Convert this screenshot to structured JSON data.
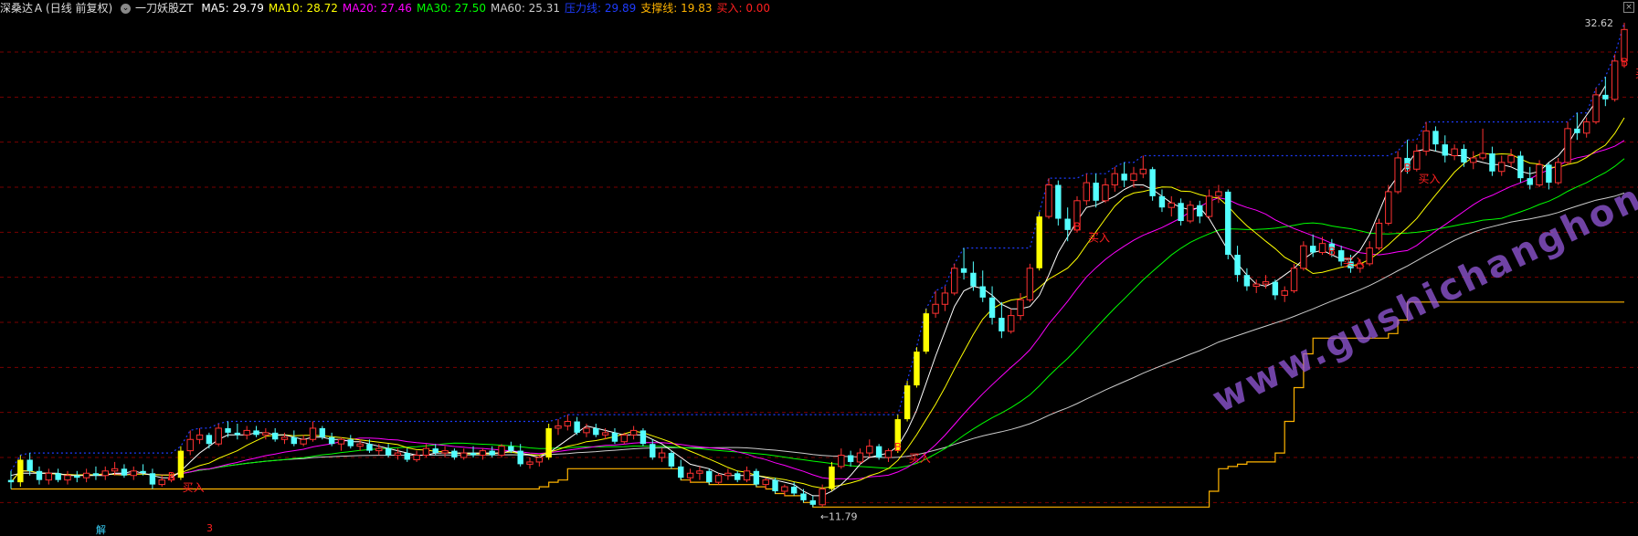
{
  "header": {
    "stock_name": "深桑达Ａ",
    "period": "(日线 前复权)",
    "indicator_name": "一刀妖股ZT",
    "items": [
      {
        "label": "MA5:",
        "value": "29.79",
        "color": "#ffffff"
      },
      {
        "label": "MA10:",
        "value": "28.72",
        "color": "#ffff00"
      },
      {
        "label": "MA20:",
        "value": "27.46",
        "color": "#ff00ff"
      },
      {
        "label": "MA30:",
        "value": "27.50",
        "color": "#00ff00"
      },
      {
        "label": "MA60:",
        "value": "25.31",
        "color": "#cccccc"
      },
      {
        "label": "压力线:",
        "value": "29.89",
        "color": "#1e3cff"
      },
      {
        "label": "支撑线:",
        "value": "19.83",
        "color": "#ffb400"
      },
      {
        "label": "买入:",
        "value": "0.00",
        "color": "#ff2020"
      }
    ]
  },
  "labels": {
    "max_price": "32.62",
    "min_price": "11.79",
    "buy_text": "买入",
    "b_marker": "B",
    "bottom_left": "解",
    "bottom_mid": "3",
    "watermark": "www.gushichanghong.com",
    "close_icon": "×"
  },
  "chart_data": {
    "type": "candlestick",
    "y_range": [
      11.0,
      33.5
    ],
    "hlines": [
      32,
      30,
      28,
      26,
      24,
      22,
      20,
      18,
      16,
      14,
      12
    ],
    "candles": [
      [
        13.0,
        13.4,
        12.6,
        12.9,
        false
      ],
      [
        12.9,
        14.1,
        12.7,
        13.9,
        true
      ],
      [
        13.9,
        14.2,
        13.2,
        13.4,
        false
      ],
      [
        13.4,
        13.6,
        12.8,
        13.0,
        false
      ],
      [
        13.0,
        13.5,
        12.8,
        13.3,
        true
      ],
      [
        13.3,
        13.5,
        12.9,
        13.0,
        false
      ],
      [
        13.0,
        13.4,
        12.8,
        13.2,
        true
      ],
      [
        13.2,
        13.4,
        12.9,
        13.1,
        false
      ],
      [
        13.1,
        13.5,
        12.9,
        13.3,
        true
      ],
      [
        13.3,
        13.6,
        13.0,
        13.2,
        false
      ],
      [
        13.2,
        13.6,
        13.0,
        13.4,
        true
      ],
      [
        13.4,
        13.8,
        13.2,
        13.5,
        true
      ],
      [
        13.5,
        13.7,
        13.1,
        13.2,
        false
      ],
      [
        13.2,
        13.6,
        13.0,
        13.4,
        true
      ],
      [
        13.4,
        13.7,
        13.2,
        13.3,
        false
      ],
      [
        13.3,
        13.5,
        12.6,
        12.8,
        false
      ],
      [
        12.8,
        13.2,
        12.7,
        13.0,
        true
      ],
      [
        13.0,
        13.3,
        12.9,
        13.1,
        true
      ],
      [
        13.1,
        14.5,
        13.0,
        14.3,
        true
      ],
      [
        14.3,
        15.2,
        14.1,
        14.8,
        true
      ],
      [
        14.8,
        15.3,
        14.6,
        15.0,
        true
      ],
      [
        15.0,
        15.1,
        14.4,
        14.6,
        false
      ],
      [
        14.6,
        15.5,
        14.5,
        15.3,
        true
      ],
      [
        15.3,
        15.6,
        14.9,
        15.1,
        false
      ],
      [
        15.1,
        15.5,
        14.8,
        15.0,
        false
      ],
      [
        15.0,
        15.4,
        14.8,
        15.2,
        true
      ],
      [
        15.2,
        15.4,
        14.9,
        15.0,
        false
      ],
      [
        15.0,
        15.3,
        14.8,
        15.1,
        true
      ],
      [
        15.1,
        15.3,
        14.7,
        14.8,
        false
      ],
      [
        14.8,
        15.1,
        14.6,
        14.9,
        true
      ],
      [
        14.9,
        15.2,
        14.5,
        14.6,
        false
      ],
      [
        14.6,
        15.0,
        14.5,
        14.8,
        true
      ],
      [
        14.8,
        15.6,
        14.7,
        15.3,
        true
      ],
      [
        15.3,
        15.4,
        14.8,
        14.9,
        false
      ],
      [
        14.9,
        15.1,
        14.5,
        14.6,
        false
      ],
      [
        14.6,
        14.9,
        14.3,
        14.8,
        true
      ],
      [
        14.8,
        15.0,
        14.4,
        14.5,
        false
      ],
      [
        14.5,
        14.8,
        14.3,
        14.6,
        true
      ],
      [
        14.6,
        14.8,
        14.2,
        14.3,
        false
      ],
      [
        14.3,
        14.6,
        14.1,
        14.4,
        true
      ],
      [
        14.4,
        14.6,
        14.0,
        14.1,
        false
      ],
      [
        14.1,
        14.4,
        13.9,
        14.2,
        true
      ],
      [
        14.2,
        14.4,
        13.8,
        13.9,
        false
      ],
      [
        13.9,
        14.3,
        13.8,
        14.1,
        true
      ],
      [
        14.1,
        14.6,
        14.0,
        14.4,
        true
      ],
      [
        14.4,
        14.6,
        14.1,
        14.2,
        false
      ],
      [
        14.2,
        14.5,
        14.0,
        14.3,
        true
      ],
      [
        14.3,
        14.4,
        13.9,
        14.0,
        false
      ],
      [
        14.0,
        14.4,
        13.9,
        14.2,
        true
      ],
      [
        14.2,
        14.5,
        14.0,
        14.1,
        false
      ],
      [
        14.1,
        14.4,
        13.9,
        14.3,
        true
      ],
      [
        14.3,
        14.5,
        14.0,
        14.1,
        false
      ],
      [
        14.1,
        14.6,
        14.0,
        14.5,
        true
      ],
      [
        14.5,
        14.7,
        14.2,
        14.3,
        false
      ],
      [
        14.3,
        14.6,
        13.6,
        13.7,
        false
      ],
      [
        13.7,
        14.0,
        13.5,
        13.8,
        true
      ],
      [
        13.8,
        14.1,
        13.6,
        14.0,
        true
      ],
      [
        14.0,
        15.5,
        13.9,
        15.3,
        true
      ],
      [
        15.3,
        15.7,
        15.0,
        15.4,
        true
      ],
      [
        15.4,
        15.9,
        15.2,
        15.6,
        true
      ],
      [
        15.6,
        15.8,
        15.0,
        15.1,
        false
      ],
      [
        15.1,
        15.5,
        14.9,
        15.3,
        true
      ],
      [
        15.3,
        15.5,
        14.9,
        15.0,
        false
      ],
      [
        15.0,
        15.3,
        14.8,
        15.1,
        true
      ],
      [
        15.1,
        15.3,
        14.6,
        14.7,
        false
      ],
      [
        14.7,
        15.1,
        14.6,
        15.0,
        true
      ],
      [
        15.0,
        15.4,
        14.8,
        15.2,
        true
      ],
      [
        15.2,
        15.3,
        14.5,
        14.6,
        false
      ],
      [
        14.6,
        14.8,
        13.9,
        14.0,
        false
      ],
      [
        14.0,
        14.4,
        13.8,
        14.2,
        true
      ],
      [
        14.2,
        14.3,
        13.5,
        13.6,
        false
      ],
      [
        13.6,
        13.9,
        13.0,
        13.1,
        false
      ],
      [
        13.1,
        13.5,
        12.9,
        13.3,
        true
      ],
      [
        13.3,
        13.6,
        13.0,
        13.4,
        true
      ],
      [
        13.4,
        13.5,
        12.8,
        12.9,
        false
      ],
      [
        12.9,
        13.3,
        12.8,
        13.2,
        true
      ],
      [
        13.2,
        13.5,
        13.0,
        13.3,
        true
      ],
      [
        13.3,
        13.4,
        12.9,
        13.0,
        false
      ],
      [
        13.0,
        13.6,
        12.9,
        13.4,
        true
      ],
      [
        13.4,
        13.5,
        12.7,
        12.8,
        false
      ],
      [
        12.8,
        13.1,
        12.6,
        13.0,
        true
      ],
      [
        13.0,
        13.1,
        12.4,
        12.5,
        false
      ],
      [
        12.5,
        12.8,
        12.3,
        12.7,
        true
      ],
      [
        12.7,
        12.9,
        12.3,
        12.4,
        false
      ],
      [
        12.4,
        12.6,
        12.0,
        12.1,
        false
      ],
      [
        12.1,
        12.3,
        11.8,
        11.9,
        false
      ],
      [
        11.9,
        12.8,
        11.8,
        12.6,
        true
      ],
      [
        12.6,
        13.8,
        12.5,
        13.6,
        true
      ],
      [
        13.6,
        14.4,
        13.5,
        14.1,
        true
      ],
      [
        14.1,
        14.3,
        13.6,
        13.8,
        false
      ],
      [
        13.8,
        14.4,
        13.7,
        14.2,
        true
      ],
      [
        14.2,
        14.8,
        14.0,
        14.5,
        true
      ],
      [
        14.5,
        14.6,
        13.9,
        14.0,
        false
      ],
      [
        14.0,
        14.4,
        13.8,
        14.3,
        true
      ],
      [
        14.3,
        15.9,
        14.2,
        15.7,
        true
      ],
      [
        15.7,
        17.4,
        15.6,
        17.2,
        true
      ],
      [
        17.2,
        18.9,
        17.1,
        18.7,
        true
      ],
      [
        18.7,
        20.6,
        18.6,
        20.4,
        true
      ],
      [
        20.4,
        21.4,
        20.2,
        20.8,
        true
      ],
      [
        20.8,
        21.6,
        20.5,
        21.3,
        true
      ],
      [
        21.3,
        22.6,
        21.2,
        22.4,
        true
      ],
      [
        22.4,
        23.3,
        21.9,
        22.2,
        false
      ],
      [
        22.2,
        22.7,
        21.4,
        21.6,
        false
      ],
      [
        21.6,
        22.3,
        20.9,
        21.1,
        false
      ],
      [
        21.1,
        21.6,
        19.9,
        20.2,
        false
      ],
      [
        20.2,
        20.9,
        19.3,
        19.6,
        false
      ],
      [
        19.6,
        20.6,
        19.5,
        20.3,
        true
      ],
      [
        20.3,
        21.3,
        20.1,
        21.0,
        true
      ],
      [
        21.0,
        22.6,
        20.9,
        22.4,
        true
      ],
      [
        22.4,
        24.9,
        22.3,
        24.7,
        true
      ],
      [
        24.7,
        26.4,
        24.6,
        26.1,
        true
      ],
      [
        26.1,
        26.3,
        24.3,
        24.6,
        false
      ],
      [
        24.6,
        25.1,
        23.6,
        24.1,
        false
      ],
      [
        24.1,
        25.6,
        24.0,
        25.4,
        true
      ],
      [
        25.4,
        26.6,
        25.2,
        26.2,
        true
      ],
      [
        26.2,
        26.6,
        25.1,
        25.4,
        false
      ],
      [
        25.4,
        26.4,
        25.3,
        26.1,
        true
      ],
      [
        26.1,
        26.9,
        25.8,
        26.6,
        true
      ],
      [
        26.6,
        27.1,
        26.0,
        26.3,
        false
      ],
      [
        26.3,
        26.9,
        26.0,
        26.6,
        true
      ],
      [
        26.6,
        27.4,
        26.4,
        26.8,
        true
      ],
      [
        26.8,
        26.9,
        25.4,
        25.6,
        false
      ],
      [
        25.6,
        25.9,
        24.9,
        25.1,
        false
      ],
      [
        25.1,
        25.6,
        24.7,
        25.3,
        true
      ],
      [
        25.3,
        25.5,
        24.3,
        24.5,
        false
      ],
      [
        24.5,
        25.4,
        24.4,
        25.2,
        true
      ],
      [
        25.2,
        25.4,
        24.4,
        24.7,
        false
      ],
      [
        24.7,
        25.9,
        24.6,
        25.6,
        true
      ],
      [
        25.6,
        26.1,
        25.3,
        25.8,
        true
      ],
      [
        25.8,
        25.9,
        22.8,
        23.0,
        false
      ],
      [
        23.0,
        23.4,
        21.8,
        22.1,
        false
      ],
      [
        22.1,
        22.4,
        21.4,
        21.6,
        false
      ],
      [
        21.6,
        21.9,
        21.3,
        21.7,
        true
      ],
      [
        21.7,
        22.1,
        21.5,
        21.8,
        true
      ],
      [
        21.8,
        21.9,
        21.0,
        21.2,
        false
      ],
      [
        21.2,
        21.6,
        20.9,
        21.4,
        true
      ],
      [
        21.4,
        22.6,
        21.3,
        22.4,
        true
      ],
      [
        22.4,
        23.6,
        22.3,
        23.4,
        true
      ],
      [
        23.4,
        23.9,
        22.9,
        23.1,
        false
      ],
      [
        23.1,
        23.8,
        23.0,
        23.5,
        true
      ],
      [
        23.5,
        23.7,
        22.9,
        23.2,
        false
      ],
      [
        23.2,
        23.4,
        22.5,
        22.7,
        false
      ],
      [
        22.7,
        23.0,
        22.2,
        22.4,
        false
      ],
      [
        22.4,
        22.8,
        22.2,
        22.6,
        true
      ],
      [
        22.6,
        23.6,
        22.5,
        23.3,
        true
      ],
      [
        23.3,
        24.6,
        23.2,
        24.4,
        true
      ],
      [
        24.4,
        26.1,
        24.3,
        25.8,
        true
      ],
      [
        25.8,
        27.6,
        25.7,
        27.3,
        true
      ],
      [
        27.3,
        28.1,
        26.6,
        26.8,
        false
      ],
      [
        26.8,
        27.9,
        26.7,
        27.6,
        true
      ],
      [
        27.6,
        28.9,
        27.4,
        28.5,
        true
      ],
      [
        28.5,
        28.7,
        27.6,
        27.9,
        false
      ],
      [
        27.9,
        28.3,
        27.1,
        27.4,
        false
      ],
      [
        27.4,
        27.9,
        27.2,
        27.7,
        true
      ],
      [
        27.7,
        27.9,
        26.9,
        27.1,
        false
      ],
      [
        27.1,
        27.6,
        26.8,
        27.3,
        true
      ],
      [
        27.3,
        28.6,
        27.2,
        27.5,
        true
      ],
      [
        27.5,
        27.8,
        26.5,
        26.7,
        false
      ],
      [
        26.7,
        27.4,
        26.5,
        27.1,
        true
      ],
      [
        27.1,
        27.7,
        26.9,
        27.4,
        true
      ],
      [
        27.4,
        27.6,
        26.2,
        26.4,
        false
      ],
      [
        26.4,
        26.9,
        25.9,
        26.1,
        false
      ],
      [
        26.1,
        27.2,
        26.0,
        27.0,
        true
      ],
      [
        27.0,
        27.1,
        25.9,
        26.2,
        false
      ],
      [
        26.2,
        27.3,
        26.1,
        27.1,
        true
      ],
      [
        27.1,
        28.9,
        27.0,
        28.6,
        true
      ],
      [
        28.6,
        29.3,
        28.1,
        28.4,
        false
      ],
      [
        28.4,
        29.1,
        28.2,
        28.9,
        true
      ],
      [
        28.9,
        30.4,
        28.8,
        30.1,
        true
      ],
      [
        30.1,
        30.9,
        29.6,
        29.9,
        false
      ],
      [
        29.9,
        31.9,
        29.8,
        31.6,
        true
      ],
      [
        31.6,
        33.3,
        31.3,
        33.0,
        true
      ]
    ],
    "ma5": [
      13.2,
      13.3,
      13.3,
      13.3,
      13.3,
      13.3,
      13.2,
      13.2,
      13.2,
      13.2,
      13.2,
      13.3,
      13.3,
      13.4,
      13.3,
      13.2,
      13.1,
      13.1,
      13.4,
      13.8,
      14.2,
      14.5,
      14.8,
      15.0,
      15.0,
      15.0,
      15.1,
      15.1,
      15.0,
      15.0,
      14.9,
      14.8,
      14.9,
      14.9,
      14.8,
      14.8,
      14.7,
      14.7,
      14.6,
      14.5,
      14.4,
      14.3,
      14.2,
      14.1,
      14.1,
      14.2,
      14.2,
      14.2,
      14.2,
      14.2,
      14.2,
      14.2,
      14.2,
      14.3,
      14.2,
      14.1,
      14.0,
      14.2,
      14.5,
      14.8,
      15.1,
      15.4,
      15.3,
      15.2,
      15.1,
      15.0,
      15.0,
      15.0,
      14.8,
      14.6,
      14.3,
      14.0,
      13.7,
      13.6,
      13.5,
      13.3,
      13.2,
      13.2,
      13.2,
      13.2,
      13.1,
      13.0,
      12.9,
      12.8,
      12.5,
      12.3,
      12.3,
      12.5,
      12.8,
      13.2,
      13.7,
      14.0,
      14.1,
      14.2,
      14.5,
      15.2,
      16.1,
      17.3,
      18.5,
      19.6,
      20.7,
      21.4,
      21.6,
      21.5,
      21.2,
      20.8,
      20.6,
      20.6,
      20.7,
      21.2,
      22.1,
      23.1,
      23.8,
      24.5,
      25.1,
      25.2,
      25.4,
      25.6,
      25.9,
      26.1,
      26.1,
      25.9,
      25.6,
      25.3,
      25.1,
      25.0,
      25.1,
      24.6,
      23.9,
      23.2,
      22.6,
      22.1,
      21.7,
      21.6,
      21.8,
      22.1,
      22.4,
      22.8,
      23.1,
      23.2,
      23.0,
      22.8,
      22.8,
      23.2,
      23.9,
      24.9,
      25.9,
      26.5,
      27.0,
      27.6,
      27.7,
      27.6,
      27.5,
      27.4,
      27.4,
      27.2,
      27.1,
      27.0,
      27.0,
      26.9,
      26.7,
      26.6,
      26.7,
      27.1,
      27.4,
      27.9,
      28.6,
      29.2,
      29.8,
      30.5
    ]
  }
}
